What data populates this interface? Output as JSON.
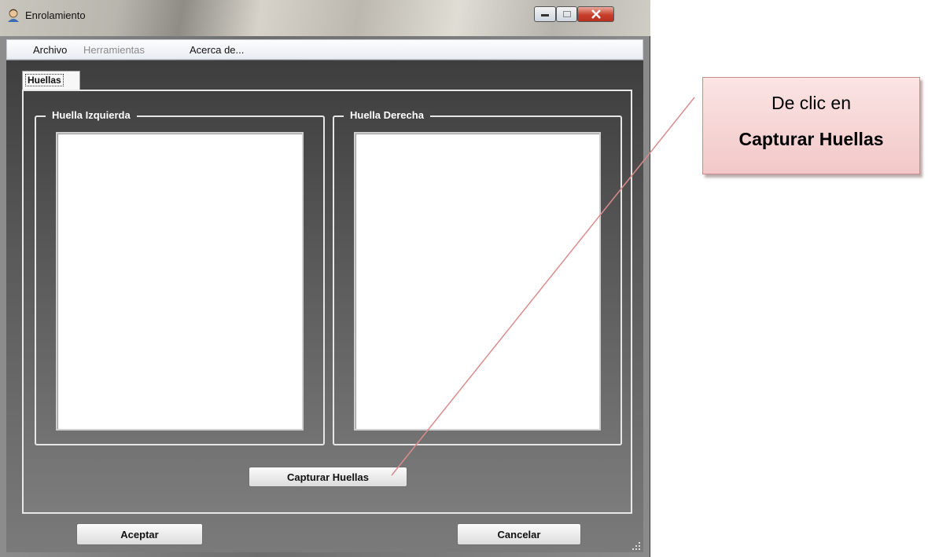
{
  "window": {
    "title": "Enrolamiento",
    "icon": "user-icon"
  },
  "menu": {
    "items": [
      {
        "label": "Archivo",
        "enabled": true
      },
      {
        "label": "Herramientas",
        "enabled": false
      },
      {
        "label": "Acerca de...",
        "enabled": true
      }
    ]
  },
  "tabs": [
    {
      "label": "Huellas",
      "selected": true
    }
  ],
  "groups": {
    "left": {
      "label": "Huella Izquierda"
    },
    "right": {
      "label": "Huella Derecha"
    }
  },
  "buttons": {
    "capture": "Capturar Huellas",
    "accept": "Aceptar",
    "cancel": "Cancelar"
  },
  "callout": {
    "line1": "De clic en",
    "line2": "Capturar Huellas",
    "color": "#f2c8c8",
    "pointer_color": "#d98c8c"
  }
}
